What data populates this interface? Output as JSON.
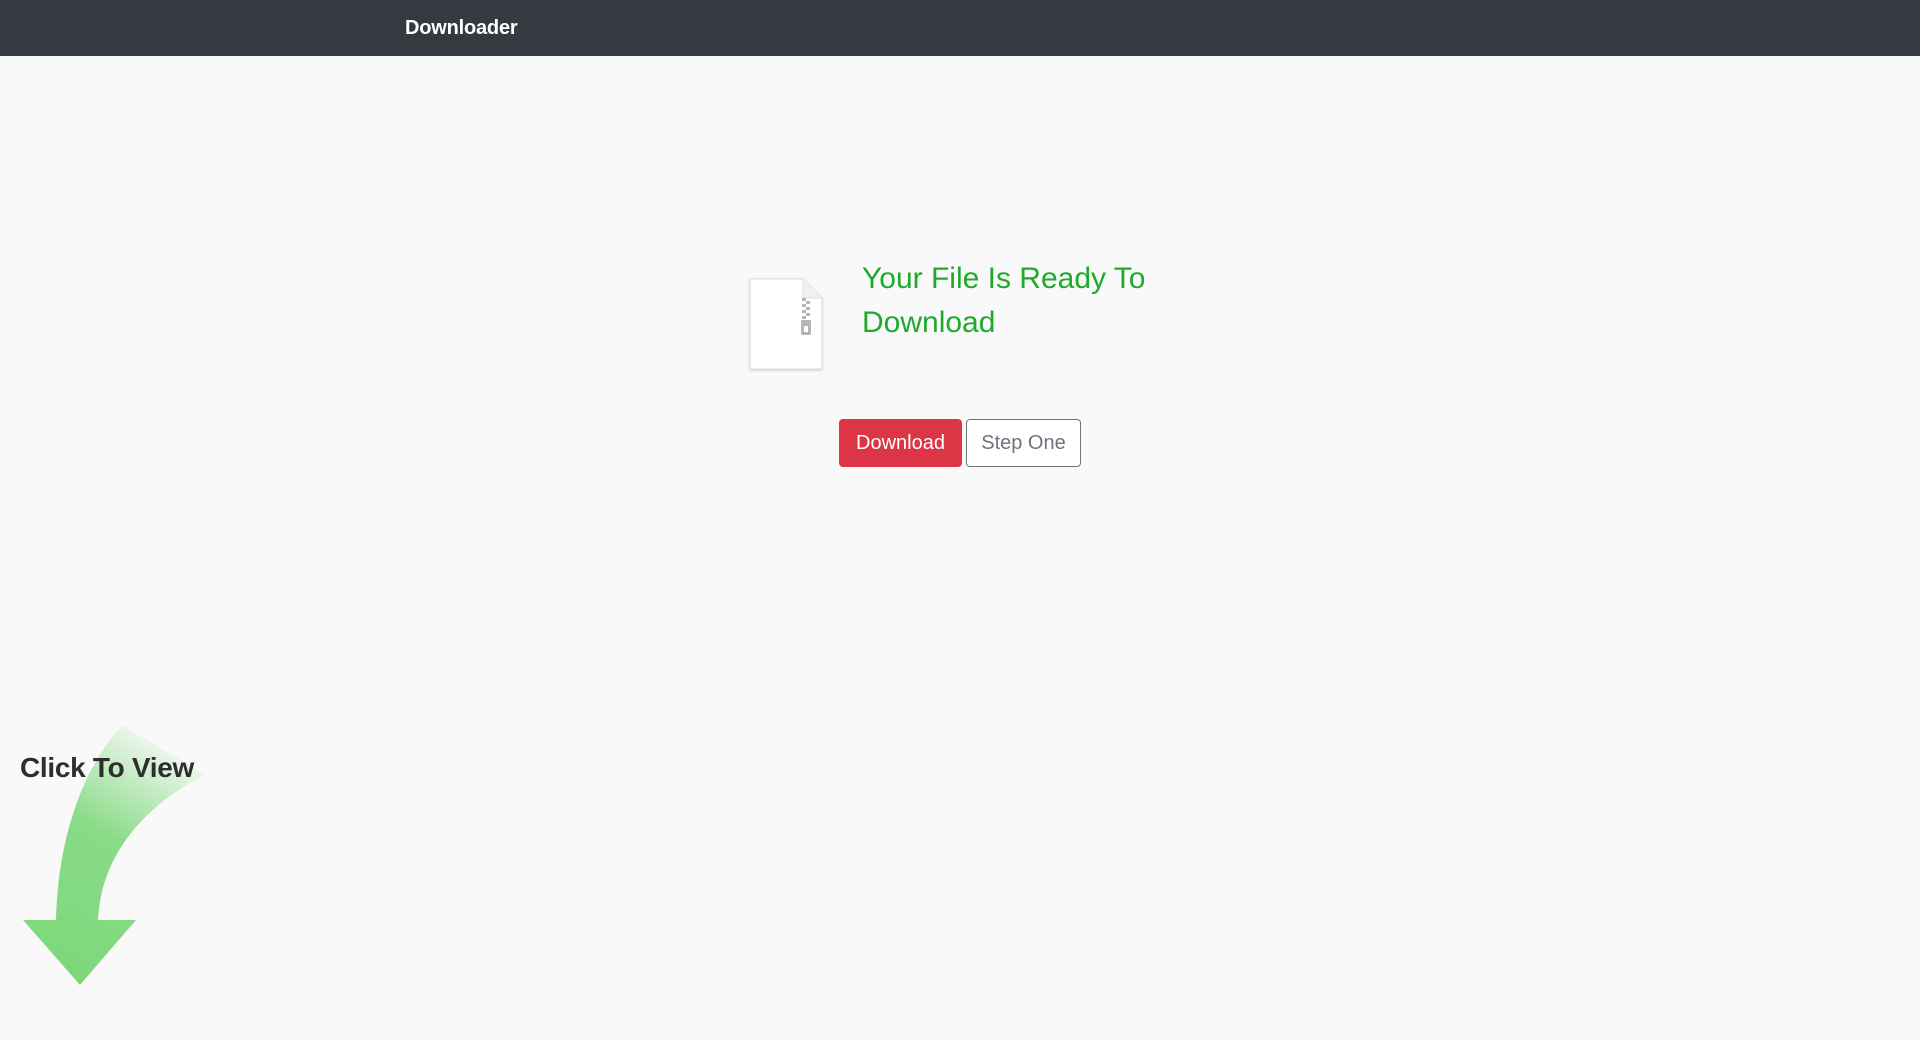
{
  "navbar": {
    "brand": "Downloader",
    "background": "#343a40"
  },
  "main": {
    "file_icon": "zip-file-icon",
    "headline": "Your File Is Ready To Download",
    "headline_color": "#1eaa2b",
    "buttons": {
      "download": "Download",
      "step_one": "Step One"
    },
    "colors": {
      "download": "#dc3545",
      "step_one_border": "#6c757d"
    }
  },
  "promo": {
    "label": "Click To View",
    "arrow_icon": "curved-down-arrow-icon",
    "arrow_color": "#7dd87a"
  }
}
